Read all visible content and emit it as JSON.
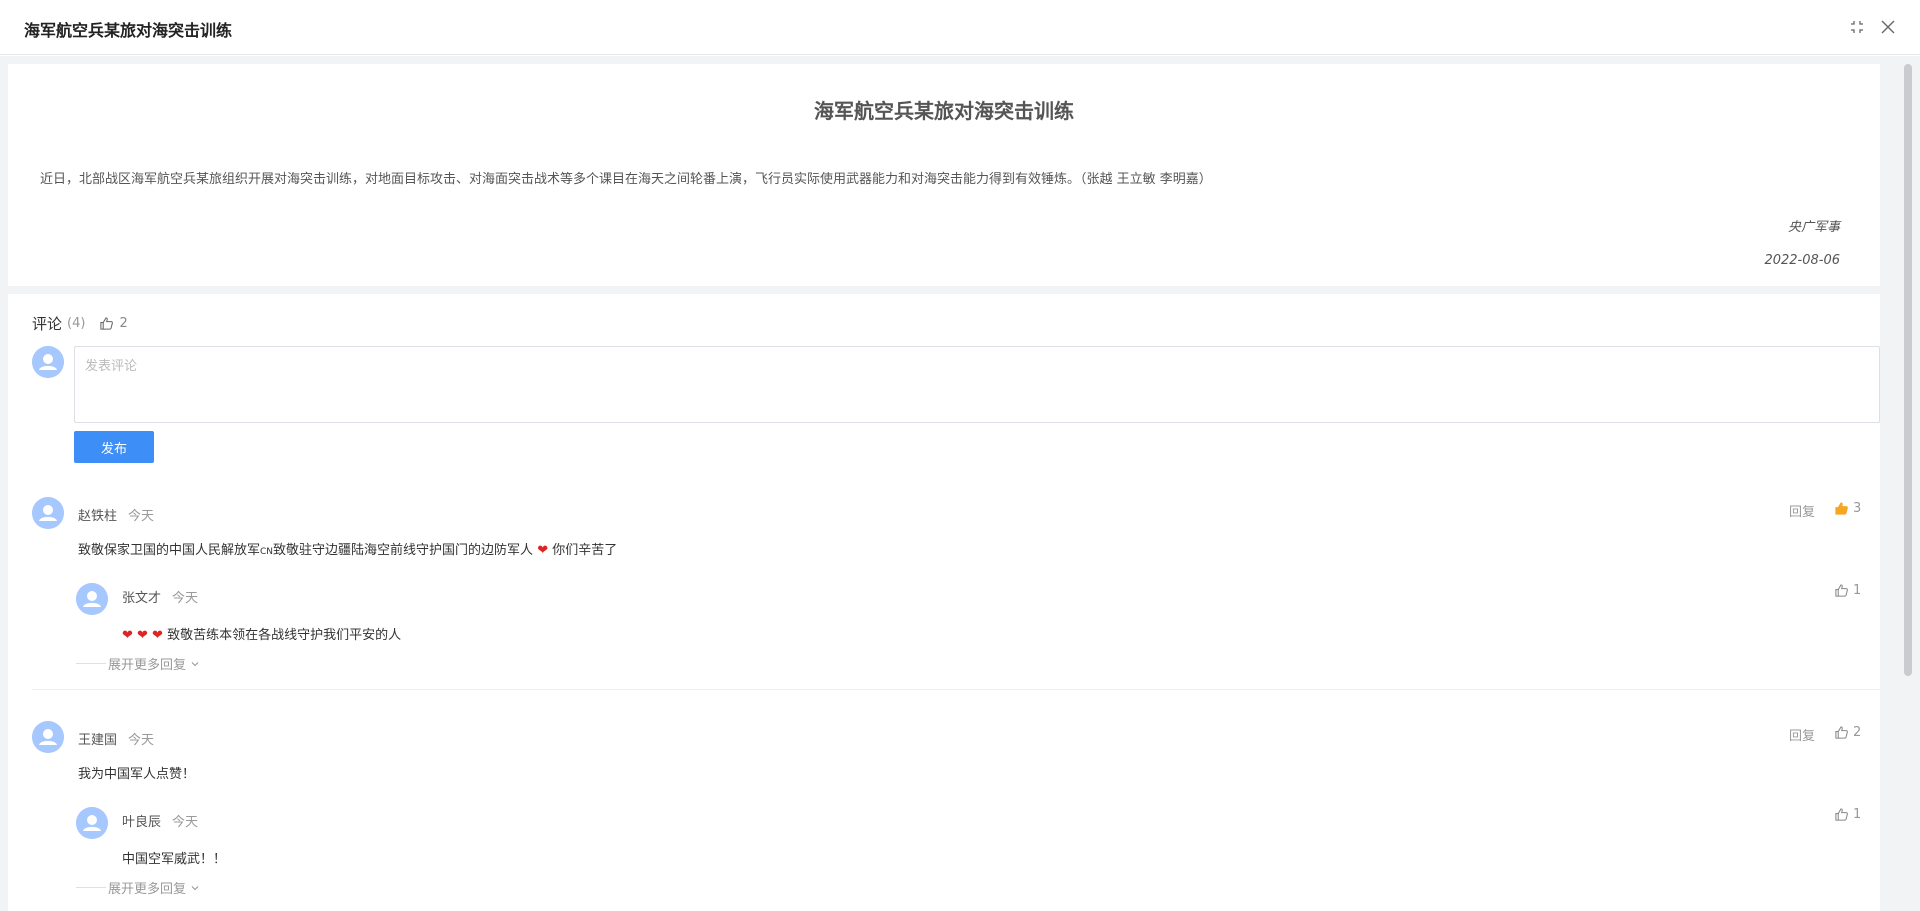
{
  "dialog": {
    "title": "海军航空兵某旅对海突击训练"
  },
  "article": {
    "title": "海军航空兵某旅对海突击训练",
    "content": "近日，北部战区海军航空兵某旅组织开展对海突击训练，对地面目标攻击、对海面突击战术等多个课目在海天之间轮番上演，飞行员实际使用武器能力和对海突击能力得到有效锤炼。（张越 王立敏 李明嘉）",
    "source": "央广军事",
    "date": "2022-08-06"
  },
  "comments": {
    "title": "评论",
    "count": "(4)",
    "likes": "2",
    "input_placeholder": "发表评论",
    "publish_label": "发布",
    "reply_label": "回复",
    "expand_label": "展开更多回复",
    "accent_color": "#3e8ef7",
    "items": [
      {
        "name": "赵铁柱",
        "time": "今天",
        "text_before": "致敬保家卫国的中国人民解放军",
        "text_flag": "CN",
        "text_mid": "致敬驻守边疆陆海空前线守护国门的边防军人",
        "heart": "❤",
        "text_after": "你们辛苦了",
        "likes": "3",
        "liked": true,
        "reply": {
          "name": "张文才",
          "time": "今天",
          "hearts": "❤ ❤ ❤",
          "text": "致敬苦练本领在各战线守护我们平安的人",
          "likes": "1"
        }
      },
      {
        "name": "王建国",
        "time": "今天",
        "text": "我为中国军人点赞！",
        "likes": "2",
        "liked": false,
        "reply": {
          "name": "叶良辰",
          "time": "今天",
          "text": "中国空军威武！！",
          "likes": "1"
        }
      }
    ]
  }
}
